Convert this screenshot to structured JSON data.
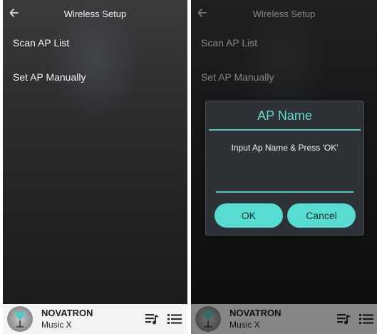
{
  "header": {
    "back_icon": "arrow-left-icon",
    "title": "Wireless Setup"
  },
  "menu": {
    "items": [
      {
        "label": "Scan AP List"
      },
      {
        "label": "Set AP Manually"
      }
    ]
  },
  "player": {
    "title": "NOVATRON",
    "subtitle": "Music X",
    "queue_icon": "queue-music-icon",
    "list_icon": "list-icon"
  },
  "dialog": {
    "title": "AP Name",
    "message": "Input Ap Name & Press 'OK'",
    "input_value": "",
    "ok_label": "OK",
    "cancel_label": "Cancel"
  },
  "colors": {
    "accent": "#57dcd2",
    "dialog_bg": "#2e3136",
    "player_bg": "#f4f4f4"
  }
}
